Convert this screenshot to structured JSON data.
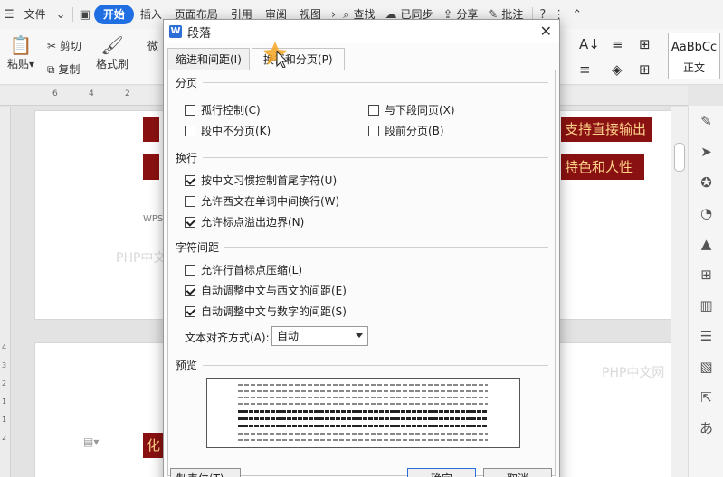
{
  "menubar": {
    "file": "文件",
    "start": "开始",
    "insert": "插入",
    "layout": "页面布局",
    "reference": "引用",
    "review": "审阅",
    "view": "视图",
    "search": "查找",
    "synced": "已同步",
    "share": "分享",
    "annotate": "批注"
  },
  "ribbon": {
    "paste": "粘贴",
    "cut": "剪切",
    "copy": "复制",
    "format_painter": "格式刷",
    "font_partial": "微",
    "style_name": "AaBbCc",
    "style_label": "正文"
  },
  "ruler": {
    "marks": [
      "6",
      "4",
      "2"
    ]
  },
  "vruler": {
    "marks": [
      "4",
      "3",
      "2",
      "1",
      "1",
      "2"
    ]
  },
  "doc": {
    "line1_tail": "支持直接输出",
    "line2_tail": "特色和人性",
    "line3": "化",
    "wps_tag": "WPS",
    "watermark1": "PHP中文网",
    "watermark2": "PHP中文网"
  },
  "colors": {
    "accent": "#1f6fe3",
    "highlight_bg": "#8a1111",
    "highlight_text": "#ffd38a"
  },
  "dialog": {
    "title": "段落",
    "tabs": [
      "缩进和间距(I)",
      "换行和分页(P)"
    ],
    "sec_paging": "分页",
    "sec_wrap": "换行",
    "sec_char": "字符间距",
    "sec_preview": "预览",
    "checkboxes": {
      "widow": {
        "label": "孤行控制(C)",
        "checked": false
      },
      "keep_next": {
        "label": "与下段同页(X)",
        "checked": false
      },
      "keep_lines": {
        "label": "段中不分页(K)",
        "checked": false
      },
      "page_break": {
        "label": "段前分页(B)",
        "checked": false
      },
      "cjk_rules": {
        "label": "按中文习惯控制首尾字符(U)",
        "checked": true
      },
      "word_break": {
        "label": "允许西文在单词中间换行(W)",
        "checked": false
      },
      "hanging_punct": {
        "label": "允许标点溢出边界(N)",
        "checked": true
      },
      "compress_punct": {
        "label": "允许行首标点压缩(L)",
        "checked": false
      },
      "auto_space_en": {
        "label": "自动调整中文与西文的间距(E)",
        "checked": true
      },
      "auto_space_num": {
        "label": "自动调整中文与数字的间距(S)",
        "checked": true
      }
    },
    "align_label": "文本对齐方式(A):",
    "align_value": "自动",
    "tabs_button": "制表位(T)...",
    "ok_button": "确定",
    "cancel_button": "取消"
  }
}
